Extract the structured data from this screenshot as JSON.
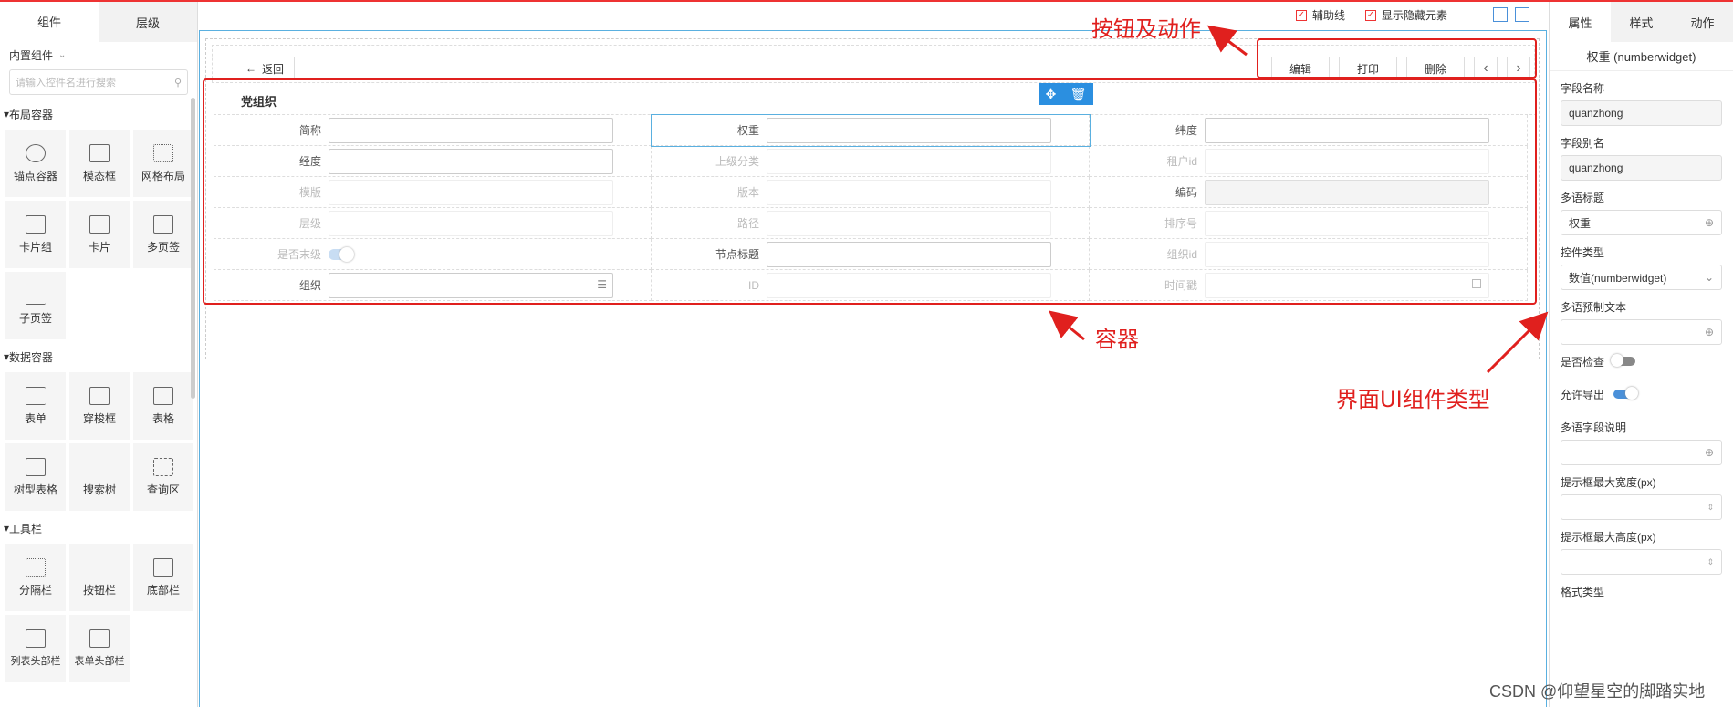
{
  "left_panel": {
    "tabs": [
      "组件",
      "层级"
    ],
    "builtin_label": "内置组件",
    "search_placeholder": "请输入控件名进行搜索",
    "groups": [
      {
        "title": "布局容器",
        "items": [
          "锚点容器",
          "模态框",
          "网格布局",
          "卡片组",
          "卡片",
          "多页签",
          "子页签"
        ]
      },
      {
        "title": "数据容器",
        "items": [
          "表单",
          "穿梭框",
          "表格",
          "树型表格",
          "搜索树",
          "查询区"
        ]
      },
      {
        "title": "工具栏",
        "items": [
          "分隔栏",
          "按钮栏",
          "底部栏",
          "列表头部栏",
          "表单头部栏"
        ]
      }
    ]
  },
  "top_toolbar": {
    "aux_line": "辅助线",
    "show_hidden": "显示隐藏元素"
  },
  "header": {
    "back_label": "返回",
    "actions": [
      "编辑",
      "打印",
      "删除"
    ]
  },
  "form": {
    "title": "党组织",
    "rows": [
      [
        {
          "label": "简称"
        },
        {
          "label": "权重"
        },
        {
          "label": "纬度"
        }
      ],
      [
        {
          "label": "经度"
        },
        {
          "label": "上级分类"
        },
        {
          "label": "租户id"
        }
      ],
      [
        {
          "label": "模版"
        },
        {
          "label": "版本"
        },
        {
          "label": "编码"
        }
      ],
      [
        {
          "label": "层级"
        },
        {
          "label": "路径"
        },
        {
          "label": "排序号"
        }
      ],
      [
        {
          "label": "是否末级"
        },
        {
          "label": "节点标题"
        },
        {
          "label": "组织id"
        }
      ],
      [
        {
          "label": "组织"
        },
        {
          "label": "ID"
        },
        {
          "label": "时间戳"
        }
      ]
    ]
  },
  "annotations": {
    "buttons_actions": "按钮及动作",
    "container": "容器",
    "ui_component_type": "界面UI组件类型"
  },
  "right_panel": {
    "tabs": [
      "属性",
      "样式",
      "动作"
    ],
    "title": "权重 (numberwidget)",
    "field_name_label": "字段名称",
    "field_name_value": "quanzhong",
    "field_alias_label": "字段别名",
    "field_alias_value": "quanzhong",
    "multilang_title_label": "多语标题",
    "multilang_title_value": "权重",
    "widget_type_label": "控件类型",
    "widget_type_value": "数值(numberwidget)",
    "multilang_preset_label": "多语预制文本",
    "check_label": "是否检查",
    "export_label": "允许导出",
    "multilang_desc_label": "多语字段说明",
    "tip_max_width_label": "提示框最大宽度(px)",
    "tip_max_height_label": "提示框最大高度(px)",
    "format_type_label": "格式类型"
  },
  "watermark": "CSDN @仰望星空的脚踏实地"
}
